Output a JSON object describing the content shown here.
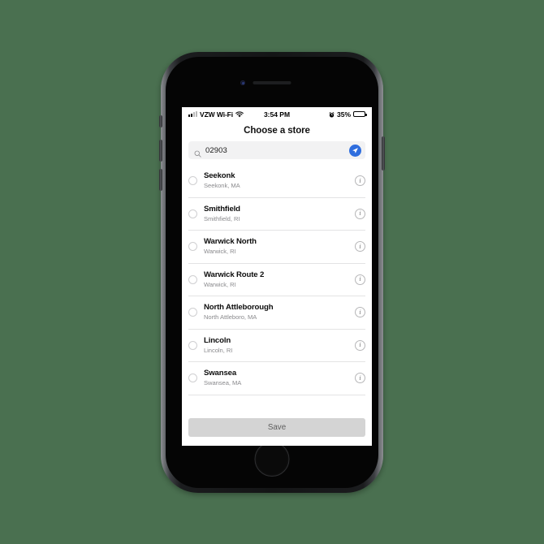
{
  "background_color": "#4a7050",
  "device": {
    "name": "iphone-8",
    "frame_color": "#1b1c1e",
    "hardware": {
      "speaker": "earpiece-speaker",
      "camera": "front-camera",
      "home_button": "home-button",
      "mute_switch": "mute-switch",
      "volume_up": "volume-up-button",
      "volume_down": "volume-down-button",
      "power": "power-button"
    }
  },
  "status_bar": {
    "carrier": "VZW Wi-Fi",
    "wifi_icon": "wifi-icon",
    "signal_icon": "cellular-signal-icon",
    "time": "3:54 PM",
    "alarm_icon": "alarm-clock-icon",
    "battery_percent": "35%",
    "battery_level": 35,
    "battery_icon": "battery-icon"
  },
  "header": {
    "title": "Choose a store"
  },
  "search": {
    "icon": "search-icon",
    "value": "02903",
    "placeholder": "Search",
    "locate_icon": "location-arrow-icon",
    "locate_color": "#2f6ede"
  },
  "stores": [
    {
      "name": "Seekonk",
      "location": "Seekonk, MA",
      "selected": false,
      "info_icon": "info-icon"
    },
    {
      "name": "Smithfield",
      "location": "Smithfield, RI",
      "selected": false,
      "info_icon": "info-icon"
    },
    {
      "name": "Warwick North",
      "location": "Warwick, RI",
      "selected": false,
      "info_icon": "info-icon"
    },
    {
      "name": "Warwick Route 2",
      "location": "Warwick, RI",
      "selected": false,
      "info_icon": "info-icon"
    },
    {
      "name": "North Attleborough",
      "location": "North Attleboro, MA",
      "selected": false,
      "info_icon": "info-icon"
    },
    {
      "name": "Lincoln",
      "location": "Lincoln, RI",
      "selected": false,
      "info_icon": "info-icon"
    },
    {
      "name": "Swansea",
      "location": "Swansea, MA",
      "selected": false,
      "info_icon": "info-icon"
    }
  ],
  "footer": {
    "save_label": "Save",
    "save_enabled": false,
    "save_bg": "#d4d4d4",
    "save_text_color": "#5e5e5e"
  }
}
